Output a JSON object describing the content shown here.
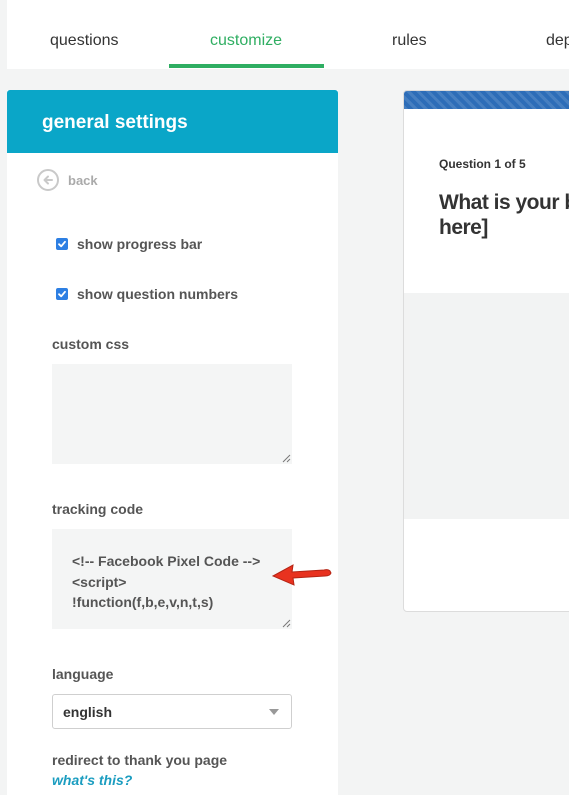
{
  "tabs": [
    {
      "label": "questions"
    },
    {
      "label": "customize",
      "active": true
    },
    {
      "label": "rules"
    },
    {
      "label": "dep"
    }
  ],
  "sidebar": {
    "title": "general settings",
    "back_label": "back",
    "show_progress_bar": {
      "label": "show progress bar",
      "checked": true
    },
    "show_question_numbers": {
      "label": "show question numbers",
      "checked": true
    },
    "custom_css": {
      "label": "custom css",
      "value": ""
    },
    "tracking_code": {
      "label": "tracking code",
      "value": "<!-- Facebook Pixel Code -->\n<script>\n!function(f,b,e,v,n,t,s)"
    },
    "language": {
      "label": "language",
      "selected": "english"
    },
    "redirect": {
      "label": "redirect to thank you page",
      "help_link": "what's this?"
    }
  },
  "preview": {
    "question_number": "Question 1 of 5",
    "question_title": "What is your benefit here]"
  },
  "colors": {
    "accent_green": "#2fae62",
    "header_blue": "#0aa6c8",
    "checkbox_blue": "#2d7fe3",
    "link_blue": "#1b9dc0",
    "arrow_red": "#e8321f"
  }
}
